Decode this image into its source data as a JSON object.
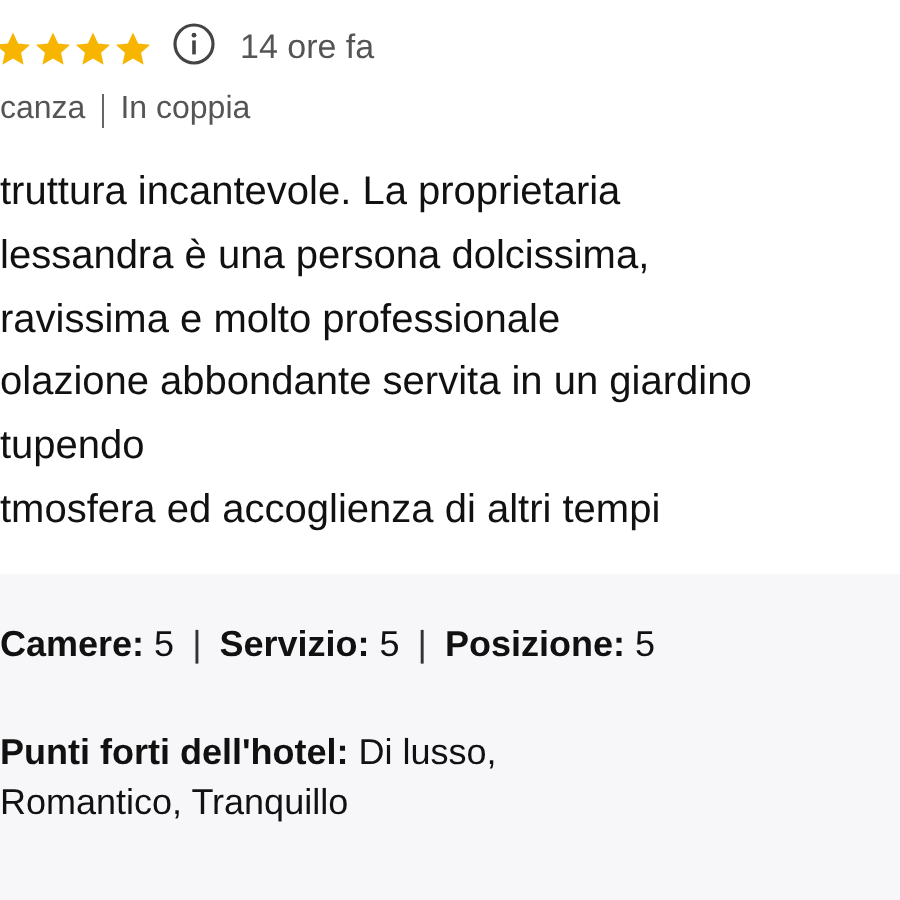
{
  "review_header": {
    "stars": 4,
    "time": "14 ore fa"
  },
  "trip_tags": [
    "canza",
    "In coppia"
  ],
  "review_lines": [
    "truttura incantevole. La proprietaria",
    "lessandra è una persona dolcissima,",
    "ravissima e molto professionale",
    "olazione abbondante servita in un giardino",
    "tupendo",
    "tmosfera ed accoglienza di altri tempi"
  ],
  "ratings": [
    "**Camere:** 5",
    "**Servizio:** 5",
    "**Posizione:** 5"
  ],
  "separator": "|",
  "highlights": "**Punti forti dell'hotel:** Di lusso, Romantico, Tranquillo"
}
